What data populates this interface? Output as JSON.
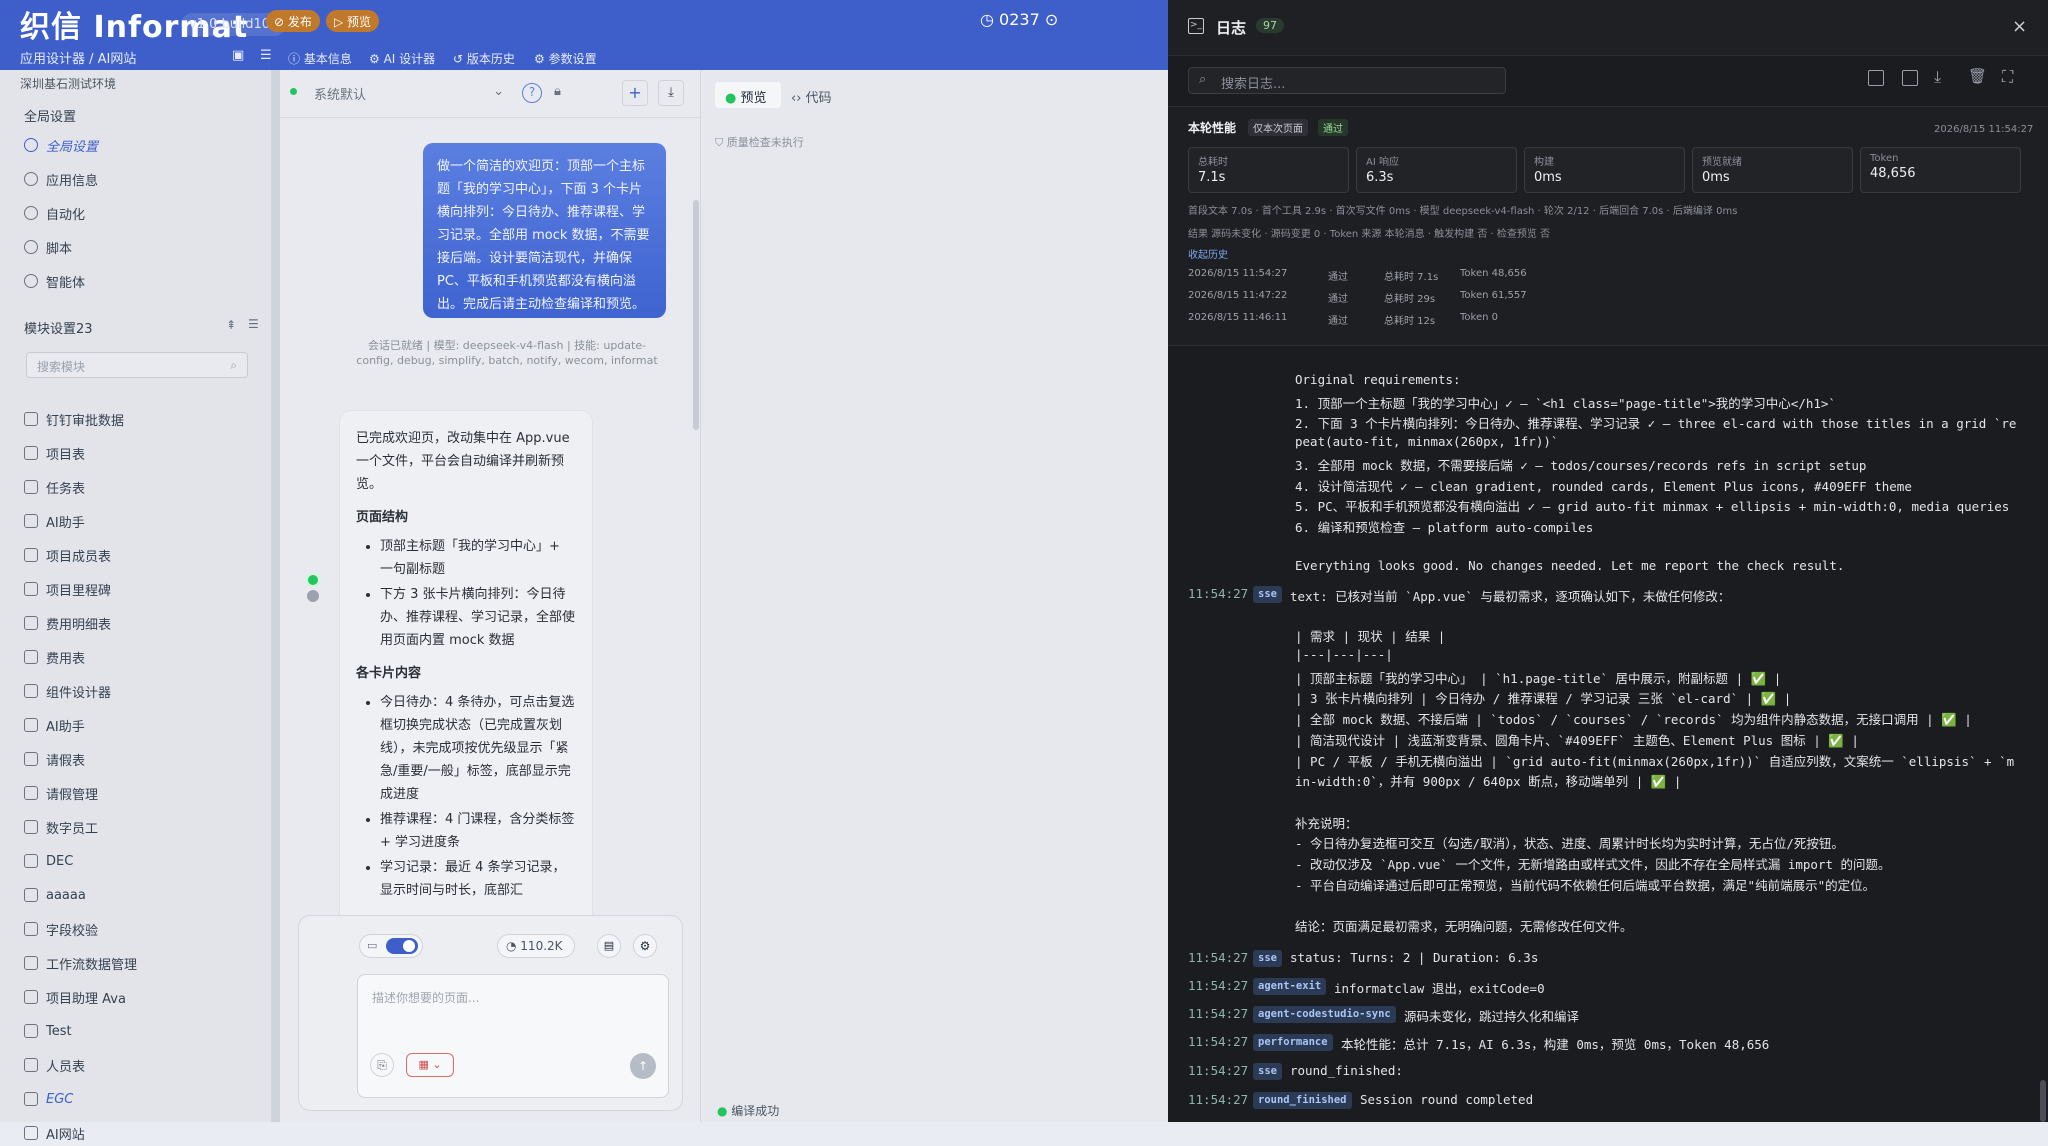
{
  "app": {
    "brand": "织信 Informat",
    "version": "v1.0 build106",
    "publish_label": "发布",
    "preview_label": "预览",
    "timer": "0237"
  },
  "toolbar": {
    "breadcrumb": "应用设计器 / AI网站",
    "tabs": [
      "基本信息",
      "AI 设计器",
      "版本历史",
      "参数设置"
    ]
  },
  "sidebar": {
    "env": "深圳基石测试环境",
    "global_title": "全局设置",
    "global_items": [
      "全局设置",
      "应用信息",
      "自动化",
      "脚本",
      "智能体"
    ],
    "module_title": "模块设置23",
    "search_placeholder": "搜索模块",
    "modules": [
      "钉钉审批数据",
      "项目表",
      "任务表",
      "AI助手",
      "项目成员表",
      "项目里程碑",
      "费用明细表",
      "费用表",
      "组件设计器",
      "AI助手",
      "请假表",
      "请假管理",
      "数字员工",
      "DEC",
      "aaaaa",
      "字段校验",
      "工作流数据管理",
      "项目助理 Ava",
      "Test",
      "人员表",
      "EGC",
      "AI网站"
    ]
  },
  "chat": {
    "model_select": "系统默认",
    "user_message": "做一个简洁的欢迎页：顶部一个主标题「我的学习中心」，下面 3 个卡片横向排列：今日待办、推荐课程、学习记录。全部用 mock 数据，不需要接后端。设计要简洁现代，并确保 PC、平板和手机预览都没有横向溢出。完成后请主动检查编译和预览。",
    "session_note": "会话已就绪 | 模型: deepseek-v4-flash | 技能: update-config, debug, simplify, batch, notify, wecom, informat",
    "ai_intro": "已完成欢迎页，改动集中在 App.vue 一个文件，平台会自动编译并刷新预览。",
    "ai_h1": "页面结构",
    "ai_struct": [
      "顶部主标题「我的学习中心」+ 一句副标题",
      "下方 3 张卡片横向排列：今日待办、推荐课程、学习记录，全部使用页面内置 mock 数据"
    ],
    "ai_h2": "各卡片内容",
    "ai_cards": [
      "今日待办：4 条待办，可点击复选框切换完成状态（已完成置灰划线），未完成项按优先级显示「紧急/重要/一般」标签，底部显示完成进度",
      "推荐课程：4 门课程，含分类标签 + 学习进度条",
      "学习记录：最近 4 条学习记录，显示时间与时长，底部汇"
    ],
    "token_count": "110.2K",
    "input_placeholder": "描述你想要的页面..."
  },
  "preview": {
    "tabs": [
      "预览",
      "代码"
    ],
    "quality_note": "质量检查未执行",
    "status": "编译成功"
  },
  "drawer": {
    "title": "日志",
    "count": "97",
    "search_placeholder": "搜索日志...",
    "perf_title": "本轮性能",
    "perf_badge_scope": "仅本次页面",
    "perf_badge_pass": "通过",
    "perf_time": "2026/8/15 11:54:27",
    "cards": [
      {
        "label": "总耗时",
        "value": "7.1s"
      },
      {
        "label": "AI 响应",
        "value": "6.3s"
      },
      {
        "label": "构建",
        "value": "0ms"
      },
      {
        "label": "预览就绪",
        "value": "0ms"
      },
      {
        "label": "Token",
        "value": "48,656"
      }
    ],
    "detail_1": "首段文本 7.0s · 首个工具 2.9s · 首次写文件 0ms · 模型 deepseek-v4-flash · 轮次 2/12 · 后端回合 7.0s · 后端编译 0ms",
    "detail_2": "结果 源码未变化 · 源码变更 0 · Token 来源 本轮消息 · 触发构建 否 · 检查预览 否",
    "collapse_history": "收起历史",
    "history": [
      {
        "time": "2026/8/15 11:54:27",
        "status": "通过",
        "duration": "总耗时 7.1s",
        "token": "Token 48,656"
      },
      {
        "time": "2026/8/15 11:47:22",
        "status": "通过",
        "duration": "总耗时 29s",
        "token": "Token 61,557"
      },
      {
        "time": "2026/8/15 11:46:11",
        "status": "通过",
        "duration": "总耗时 12s",
        "token": "Token 0"
      }
    ],
    "log_text": [
      "Original requirements:",
      "1. 顶部一个主标题「我的学习中心」✓ — `<h1 class=\"page-title\">我的学习中心</h1>`",
      "2. 下面 3 个卡片横向排列：今日待办、推荐课程、学习记录 ✓ — three el-card with those titles in a grid `re",
      "peat(auto-fit, minmax(260px, 1fr))`",
      "3. 全部用 mock 数据，不需要接后端 ✓ — todos/courses/records refs in script setup",
      "4. 设计简洁现代 ✓ — clean gradient, rounded cards, Element Plus icons, #409EFF theme",
      "5. PC、平板和手机预览都没有横向溢出 ✓ — grid auto-fit minmax + ellipsis + min-width:0, media queries",
      "6. 编译和预览检查 — platform auto-compiles",
      "",
      "Everything looks good. No changes needed. Let me report the check result."
    ],
    "entry_text_head": "text: 已核对当前 `App.vue` 与最初需求，逐项确认如下，未做任何修改：",
    "entry_text_body": [
      "| 需求 | 现状 | 结果 |",
      "|---|---|---|",
      "| 顶部主标题「我的学习中心」 | `h1.page-title` 居中展示，附副标题 | ✅ |",
      "| 3 张卡片横向排列 | 今日待办 / 推荐课程 / 学习记录 三张 `el-card` | ✅ |",
      "| 全部 mock 数据、不接后端 | `todos` / `courses` / `records` 均为组件内静态数据，无接口调用 | ✅ |",
      "| 简洁现代设计 | 浅蓝渐变背景、圆角卡片、`#409EFF` 主题色、Element Plus 图标 | ✅ |",
      "| PC / 平板 / 手机无横向溢出 | `grid auto-fit(minmax(260px,1fr))` 自适应列数，文案统一 `ellipsis` + `m",
      "in-width:0`，并有 900px / 640px 断点，移动端单列 | ✅ |",
      "",
      "补充说明：",
      "- 今日待办复选框可交互（勾选/取消），状态、进度、周累计时长均为实时计算，无占位/死按钮。",
      "- 改动仅涉及 `App.vue` 一个文件，无新增路由或样式文件，因此不存在全局样式漏 import 的问题。",
      "- 平台自动编译通过后即可正常预览，当前代码不依赖任何后端或平台数据，满足\"纯前端展示\"的定位。",
      "",
      "结论：页面满足最初需求，无明确问题，无需修改任何文件。"
    ],
    "entries": [
      {
        "time": "11:54:27",
        "tag": "sse",
        "text": "text: 已核对当前 `App.vue` 与最初需求，逐项确认如下，未做任何修改："
      },
      {
        "time": "11:54:27",
        "tag": "sse",
        "text": "status: Turns: 2 | Duration: 6.3s"
      },
      {
        "time": "11:54:27",
        "tag": "agent-exit",
        "text": "informatclaw 退出，exitCode=0"
      },
      {
        "time": "11:54:27",
        "tag": "agent-codestudio-sync",
        "text": "源码未变化，跳过持久化和编译"
      },
      {
        "time": "11:54:27",
        "tag": "performance",
        "text": "本轮性能：总计 7.1s，AI 6.3s，构建 0ms，预览 0ms，Token 48,656"
      },
      {
        "time": "11:54:27",
        "tag": "sse",
        "text": "round_finished:"
      },
      {
        "time": "11:54:27",
        "tag": "round_finished",
        "text": "Session round completed"
      }
    ]
  }
}
